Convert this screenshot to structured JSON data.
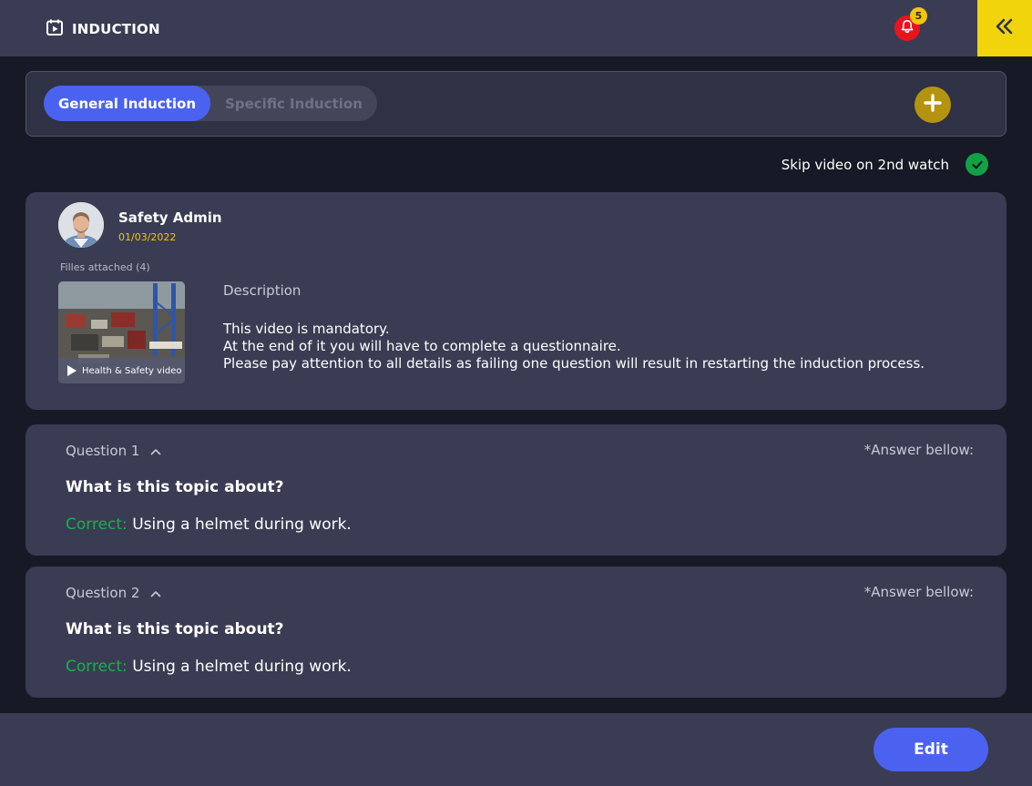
{
  "header": {
    "title": "INDUCTION",
    "title_icon": "calendar-play-icon",
    "notification_icon": "bell-icon",
    "notification_count": "5",
    "collapse_icon": "double-chevron-left-icon"
  },
  "tabs": {
    "items": [
      {
        "label": "General Induction",
        "active": true
      },
      {
        "label": "Specific Induction",
        "active": false
      }
    ],
    "add_icon": "plus-icon"
  },
  "settings": {
    "skip_label": "Skip video on 2nd watch",
    "skip_enabled": true
  },
  "video_card": {
    "author": "Safety Admin",
    "date": "01/03/2022",
    "files_label": "Filles attached (4)",
    "video_caption": "Health & Safety video",
    "description_title": "Description",
    "description_lines": [
      "This video is mandatory.",
      "At the end of it you will have to complete a questionnaire.",
      "Please pay attention to all details as failing one question will result in restarting the induction process."
    ]
  },
  "questions": [
    {
      "label": "Question 1",
      "note": "*Answer bellow:",
      "question": "What is this topic about?",
      "answer_prefix": "Correct:",
      "answer": "Using a helmet during work."
    },
    {
      "label": "Question 2",
      "note": "*Answer bellow:",
      "question": "What is this topic about?",
      "answer_prefix": "Correct:",
      "answer": "Using a helmet during work."
    }
  ],
  "footer": {
    "edit_label": "Edit"
  },
  "colors": {
    "accent_blue": "#4b62f0",
    "accent_yellow": "#f2d40c",
    "success_green": "#17b24a",
    "alert_red": "#e8141c",
    "card_bg": "#3a3c53"
  }
}
